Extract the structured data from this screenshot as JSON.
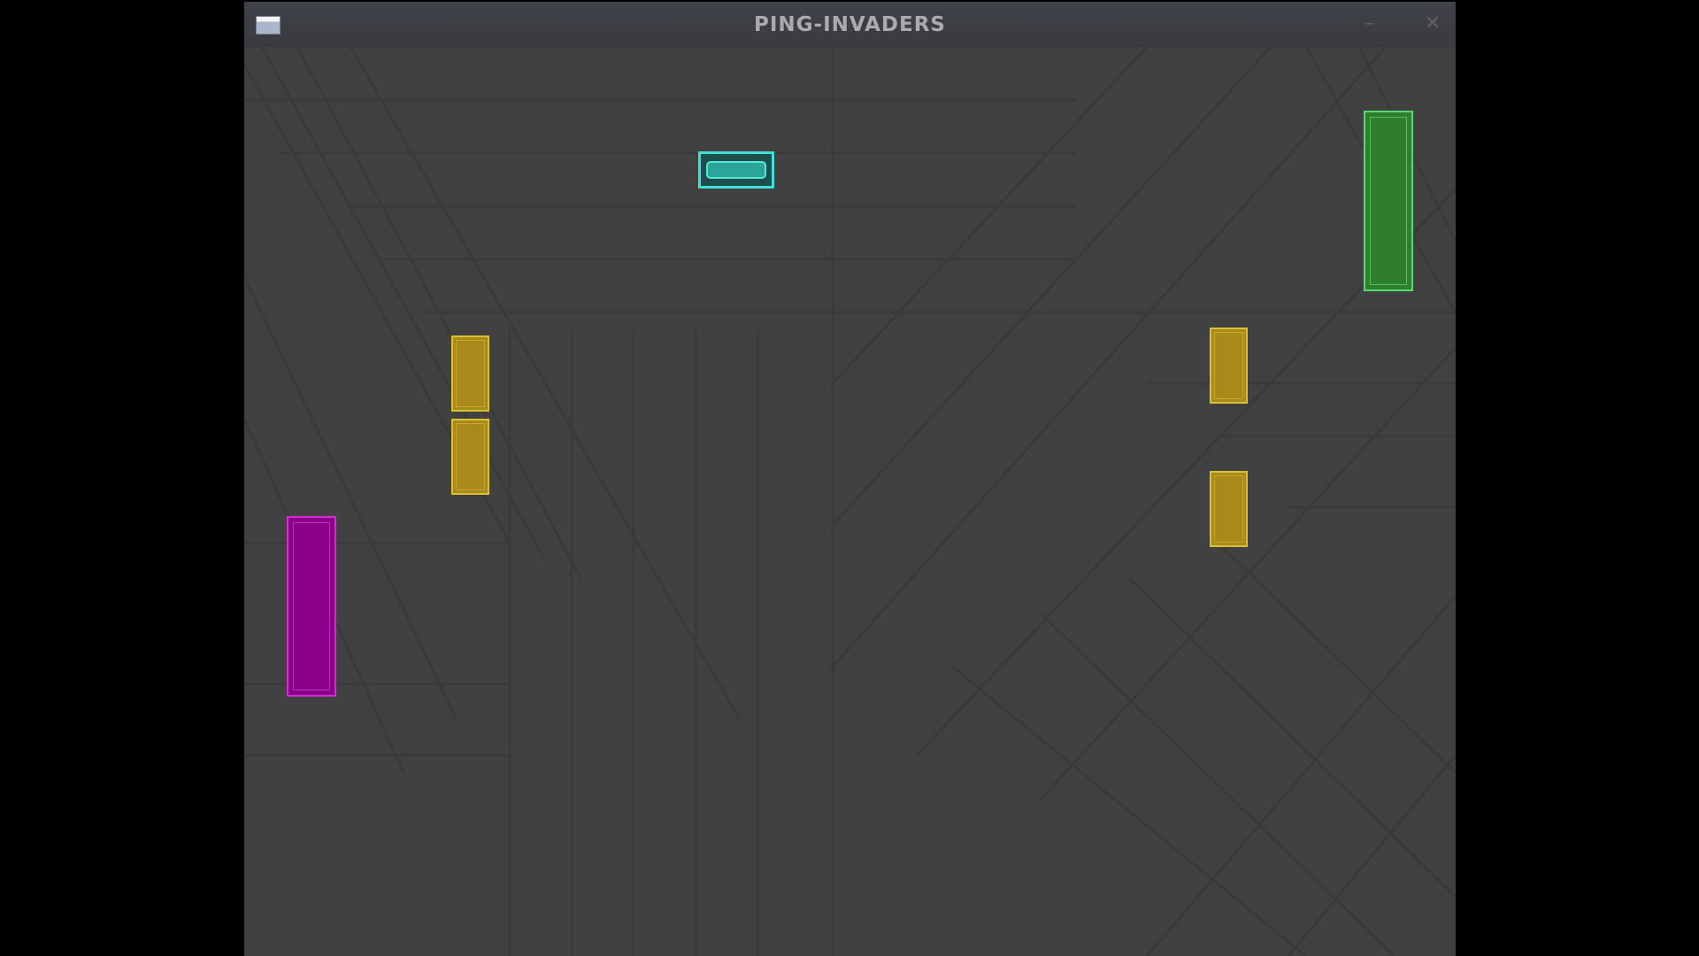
{
  "window": {
    "title": "PING-INVADERS",
    "minimize_glyph": "–",
    "close_glyph": "✕",
    "icons": [
      "window-app-icon",
      "minimize-icon",
      "close-icon"
    ]
  },
  "game": {
    "entities": [
      "left-paddle",
      "right-paddle",
      "ball",
      "invader-block",
      "invader-block",
      "invader-block",
      "invader-block"
    ],
    "colors": {
      "background": "#414141",
      "left_paddle": "#8a0089",
      "right_paddle": "#2f7d2d",
      "ball": "#3fe0d6",
      "blocks": "#a88a1a"
    }
  }
}
